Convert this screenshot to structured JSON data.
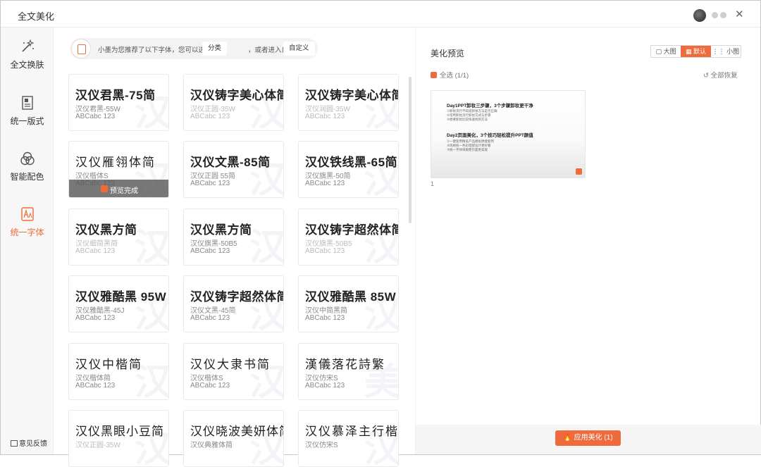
{
  "window": {
    "title": "全文美化"
  },
  "sidebar": {
    "items": [
      {
        "label": "全文换肤",
        "icon": "magic-wand-icon"
      },
      {
        "label": "统一版式",
        "icon": "layout-icon"
      },
      {
        "label": "智能配色",
        "icon": "color-circles-icon"
      },
      {
        "label": "统一字体",
        "icon": "font-icon"
      }
    ],
    "active_index": 3,
    "feedback": "意见反馈"
  },
  "tip": {
    "text1": "小墨为您推荐了以下字体，您可以选择",
    "btn1": "分类",
    "text2": "，或者进入自定义",
    "btn2": "自定义"
  },
  "fonts": [
    {
      "name": "汉仪君黑-75简",
      "sub1": "汉仪君黑-55W",
      "sub2": "ABCabc 123",
      "light": false,
      "wm": "汉"
    },
    {
      "name": "汉仪铸字美心体简",
      "sub1": "汉仪正圆-35W",
      "sub2": "ABCabc 123",
      "light": true,
      "wm": "汉"
    },
    {
      "name": "汉仪铸字美心体简",
      "sub1": "汉仪润圆-35W",
      "sub2": "ABCabc 123",
      "light": true,
      "wm": "汉"
    },
    {
      "name": "汉仪雁翎体简",
      "sub1": "汉仪楷体S",
      "sub2": "ABCabc 123",
      "light": false,
      "wm": "汉",
      "style": "light",
      "overlay": "预览完成"
    },
    {
      "name": "汉仪文黑-85简",
      "sub1": "汉仪正圆 55简",
      "sub2": "ABCabc 123",
      "light": false,
      "wm": "汉"
    },
    {
      "name": "汉仪铁线黑-65简",
      "sub1": "汉仪旗黑-50简",
      "sub2": "ABCabc 123",
      "light": false,
      "wm": "汉"
    },
    {
      "name": "汉仪黑方简",
      "sub1": "汉仪细简黑简",
      "sub2": "ABCabc 123",
      "light": true,
      "wm": "汉"
    },
    {
      "name": "汉仪黑方简",
      "sub1": "汉仪旗黑-50B5",
      "sub2": "ABCabc 123",
      "light": false,
      "wm": "汉"
    },
    {
      "name": "汉仪铸字超然体简",
      "sub1": "汉仪旗黑-50B5",
      "sub2": "ABCabc 123",
      "light": true,
      "wm": "汉"
    },
    {
      "name": "汉仪雅酷黑 95W",
      "sub1": "汉仪雅酷黑-45J",
      "sub2": "ABCabc 123",
      "light": false,
      "wm": "汉"
    },
    {
      "name": "汉仪铸字超然体简",
      "sub1": "汉仪文黑-45简",
      "sub2": "ABCabc 123",
      "light": false,
      "wm": "汉"
    },
    {
      "name": "汉仪雅酷黑 85W",
      "sub1": "汉仪中简黑简",
      "sub2": "ABCabc 123",
      "light": false,
      "wm": "汉"
    },
    {
      "name": "汉仪中楷简",
      "sub1": "汉仪楷体简",
      "sub2": "ABCabc 123",
      "light": false,
      "wm": "汉",
      "style": "light"
    },
    {
      "name": "汉仪大隶书简",
      "sub1": "汉仪楷体S",
      "sub2": "ABCabc 123",
      "light": false,
      "wm": "汉",
      "style": "light"
    },
    {
      "name": "漢儀落花詩繁",
      "sub1": "汉仪仿宋S",
      "sub2": "ABCabc 123",
      "light": false,
      "wm": "美",
      "style": "light"
    },
    {
      "name": "汉仪黑眼小豆简",
      "sub1": "汉仪正圆-35W",
      "sub2": "",
      "light": true,
      "wm": "汉",
      "style": "thin"
    },
    {
      "name": "汉仪晓波美妍体简",
      "sub1": "汉仪典雅体简",
      "sub2": "",
      "light": false,
      "wm": "汉",
      "style": "thin"
    },
    {
      "name": "汉仪慕泽主行楷精种版W",
      "sub1": "汉仪仿宋S",
      "sub2": "",
      "light": false,
      "wm": "汉",
      "style": "light"
    }
  ],
  "preview": {
    "title": "美化预览",
    "views": [
      "大图",
      "默认",
      "小图"
    ],
    "active_view": 1,
    "select_all": "全选 (1/1)",
    "restore": "全部恢复",
    "page_number": "1",
    "slide": {
      "h1": "Day1PPT卸妆三步骤，3个步骤卸妆更干净",
      "l1": "①卸妆流行不知道卸妆方法是否正确",
      "l2": "②常用卸妆流行卸妆方式与步骤",
      "l3": "③想要卸妆比较快速找到方法",
      "h2": "Day2页面美化，3个技巧轻松提升PPT颜值",
      "l4": "①一键套用精美产品模板便捷套用",
      "l5": "②风格统一色彩搭配设计更好看",
      "l6": "③统一字体排版使页面更美观"
    },
    "apply_label": "应用美化 (1)"
  },
  "colors": {
    "accent": "#ef6a3c"
  }
}
